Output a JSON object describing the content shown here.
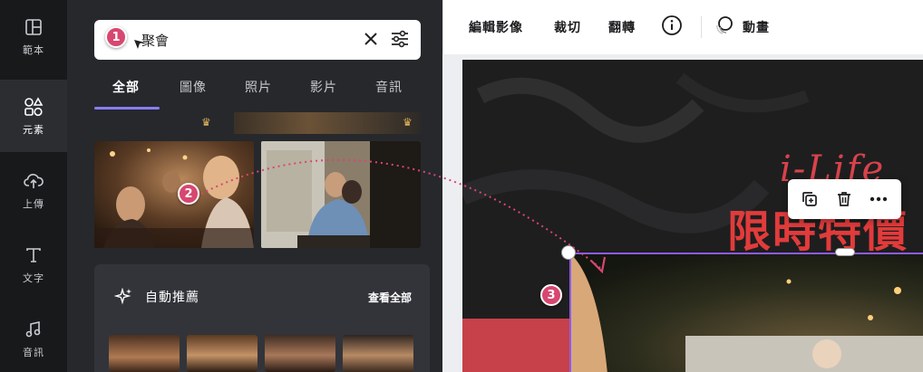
{
  "rail": {
    "items": [
      {
        "label": "範本",
        "icon": "template-icon"
      },
      {
        "label": "元素",
        "icon": "elements-icon"
      },
      {
        "label": "上傳",
        "icon": "upload-icon"
      },
      {
        "label": "文字",
        "icon": "text-icon"
      },
      {
        "label": "音訊",
        "icon": "audio-icon"
      }
    ],
    "active_index": 1
  },
  "search": {
    "value": "聚會",
    "placeholder": "聚會"
  },
  "tabs": [
    {
      "label": "全部"
    },
    {
      "label": "圖像"
    },
    {
      "label": "照片"
    },
    {
      "label": "影片"
    },
    {
      "label": "音訊"
    }
  ],
  "auto_recommend": {
    "title": "自動推薦",
    "see_all": "查看全部"
  },
  "toolbar": {
    "edit_image": "編輯影像",
    "crop": "裁切",
    "flip": "翻轉",
    "animate": "動畫"
  },
  "design": {
    "script_text": "i-Life",
    "headline": "限時特價"
  },
  "steps": {
    "one": "1",
    "two": "2",
    "three": "3"
  },
  "colors": {
    "accent": "#8b7cf6",
    "selection": "#8b5cf6",
    "step_badge": "#d7476f",
    "headline_red": "#e23b3b",
    "rail_bg": "#18191b",
    "panel_bg": "#26282c"
  }
}
